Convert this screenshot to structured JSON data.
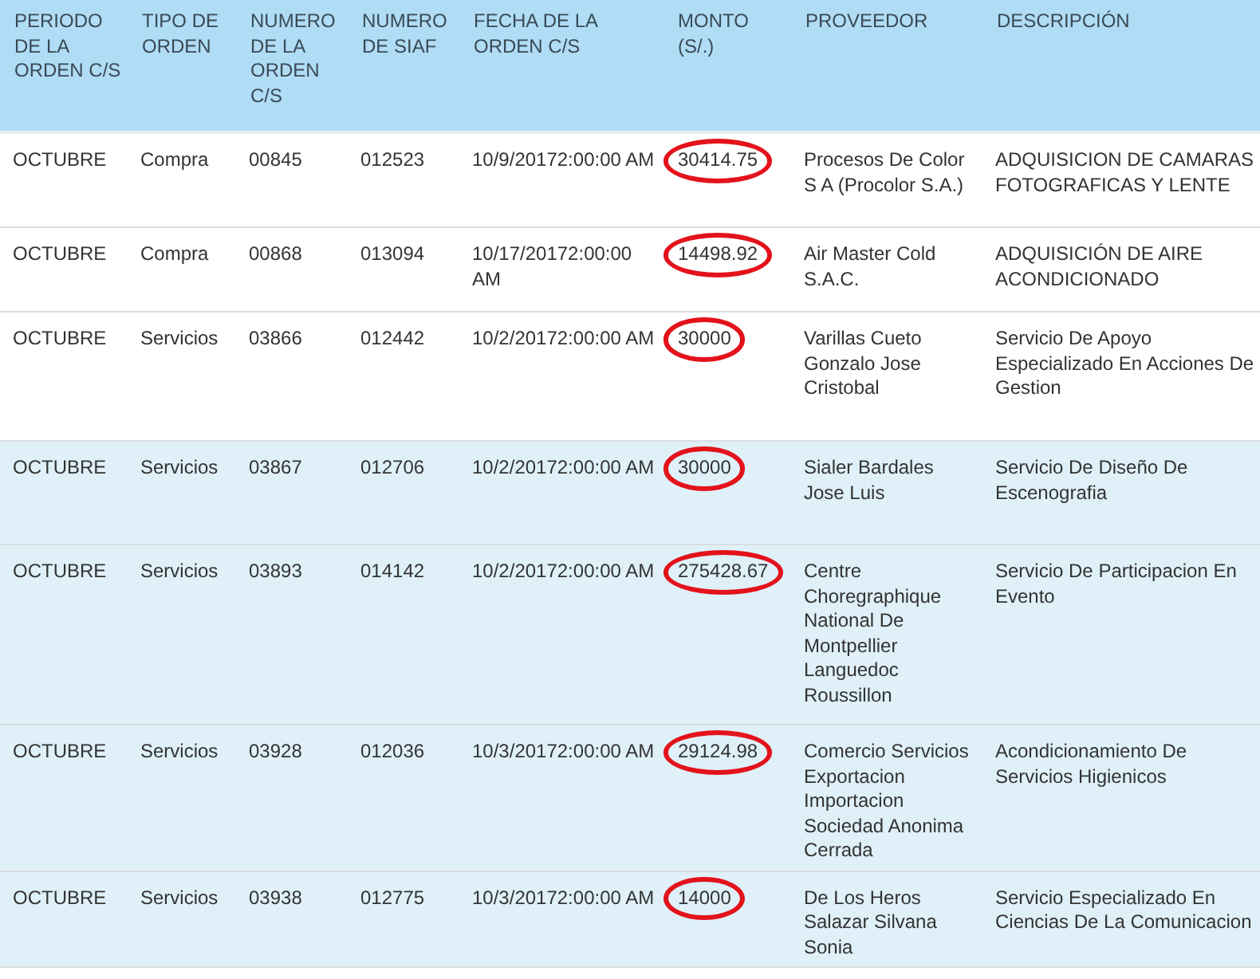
{
  "columns": [
    "PERIODO DE LA ORDEN C/S",
    "TIPO DE ORDEN",
    "NUMERO DE LA ORDEN C/S",
    "NUMERO DE SIAF",
    "FECHA DE LA ORDEN C/S",
    "MONTO (S/.)",
    "PROVEEDOR",
    "DESCRIPCIÓN"
  ],
  "rows": [
    {
      "shaded": false,
      "circled": true,
      "cells": [
        "OCTUBRE",
        "Compra",
        "00845",
        "012523",
        "10/9/20172:00:00 AM",
        "30414.75",
        "Procesos De Color S A (Procolor S.A.)",
        "ADQUISICION DE CAMARAS FOTOGRAFICAS Y LENTE"
      ]
    },
    {
      "shaded": false,
      "circled": true,
      "cells": [
        "OCTUBRE",
        "Compra",
        "00868",
        "013094",
        "10/17/20172:00:00 AM",
        "14498.92",
        "Air Master Cold S.A.C.",
        "ADQUISICIÓN DE AIRE ACONDICIONADO"
      ]
    },
    {
      "shaded": false,
      "circled": true,
      "cells": [
        "OCTUBRE",
        "Servicios",
        "03866",
        "012442",
        "10/2/20172:00:00 AM",
        "30000",
        "Varillas Cueto Gonzalo Jose Cristobal",
        "Servicio De Apoyo Especializado En Acciones De Gestion"
      ]
    },
    {
      "shaded": true,
      "circled": true,
      "cells": [
        "OCTUBRE",
        "Servicios",
        "03867",
        "012706",
        "10/2/20172:00:00 AM",
        "30000",
        "Sialer Bardales Jose Luis",
        "Servicio De Diseño De Escenografia"
      ]
    },
    {
      "shaded": true,
      "circled": true,
      "cells": [
        "OCTUBRE",
        "Servicios",
        "03893",
        "014142",
        "10/2/20172:00:00 AM",
        "275428.67",
        "Centre Choregraphique National De Montpellier Languedoc Roussillon",
        "Servicio De Participacion En Evento"
      ]
    },
    {
      "shaded": true,
      "circled": true,
      "cells": [
        "OCTUBRE",
        "Servicios",
        "03928",
        "012036",
        "10/3/20172:00:00 AM",
        "29124.98",
        "Comercio Servicios Exportacion Importacion Sociedad Anonima Cerrada",
        "Acondicionamiento De Servicios Higienicos"
      ]
    },
    {
      "shaded": true,
      "circled": true,
      "cells": [
        "OCTUBRE",
        "Servicios",
        "03938",
        "012775",
        "10/3/20172:00:00 AM",
        "14000",
        "De Los Heros Salazar Silvana Sonia",
        "Servicio Especializado En Ciencias De La Comunicacion"
      ]
    }
  ]
}
